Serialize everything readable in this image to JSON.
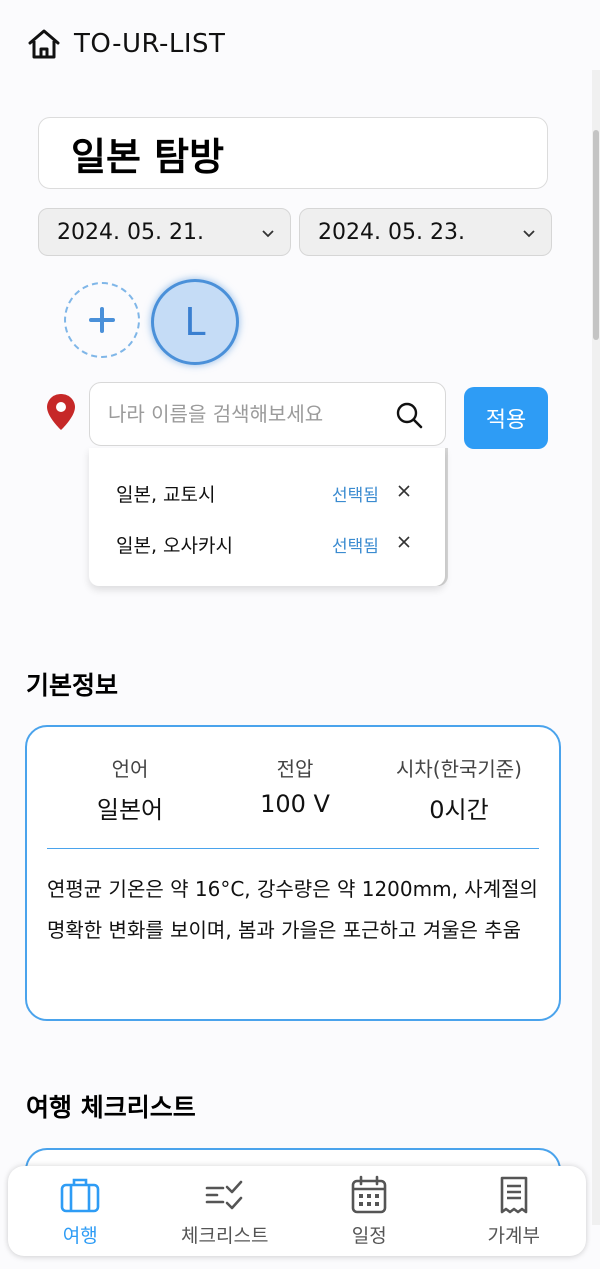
{
  "header": {
    "title": "TO-UR-LIST",
    "icon": "home-icon"
  },
  "trip": {
    "title": "일본 탐방",
    "start_date": "2024. 05. 21.",
    "end_date": "2024. 05. 23."
  },
  "members": {
    "add_icon": "plus-icon",
    "avatar_initial": "L"
  },
  "search": {
    "placeholder": "나라 이름을 검색해보세요",
    "value": "",
    "apply_label": "적용",
    "results": [
      {
        "name": "일본, 교토시",
        "status": "선택됨"
      },
      {
        "name": "일본, 오사카시",
        "status": "선택됨"
      }
    ]
  },
  "basic_info": {
    "section_title": "기본정보",
    "language_label": "언어",
    "language_value": "일본어",
    "voltage_label": "전압",
    "voltage_value": "100 V",
    "timezone_label": "시차(한국기준)",
    "timezone_value": "0시간",
    "description": "연평균 기온은 약 16°C, 강수량은 약 1200mm, 사계절의 명확한 변화를 보이며, 봄과 가을은 포근하고 겨울은 추움"
  },
  "checklist": {
    "section_title": "여행 체크리스트"
  },
  "nav": {
    "items": [
      {
        "label": "여행",
        "icon": "suitcase-icon",
        "active": true
      },
      {
        "label": "체크리스트",
        "icon": "checklist-icon",
        "active": false
      },
      {
        "label": "일정",
        "icon": "calendar-icon",
        "active": false
      },
      {
        "label": "가계부",
        "icon": "receipt-icon",
        "active": false
      }
    ]
  },
  "colors": {
    "accent": "#2e9cf5",
    "card_border": "#4aa3ec",
    "pin": "#c62828"
  }
}
